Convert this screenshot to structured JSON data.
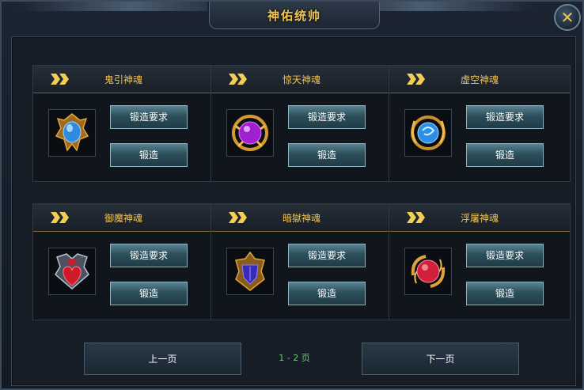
{
  "window": {
    "title": "神佑统帅",
    "close_icon": "close-x-icon"
  },
  "cards": [
    {
      "name": "鬼引神魂",
      "req_label": "锻造要求",
      "forge_label": "锻造",
      "icon": "blue-crystal-emblem-icon",
      "color": "#2f8be0"
    },
    {
      "name": "惊天神魂",
      "req_label": "锻造要求",
      "forge_label": "锻造",
      "icon": "purple-orb-emblem-icon",
      "color": "#a020d0"
    },
    {
      "name": "虚空神魂",
      "req_label": "锻造要求",
      "forge_label": "锻造",
      "icon": "blue-swirl-orb-icon",
      "color": "#2a8fe8"
    },
    {
      "name": "御魔神魂",
      "req_label": "锻造要求",
      "forge_label": "锻造",
      "icon": "red-heart-shield-icon",
      "color": "#d01a2a"
    },
    {
      "name": "暗獄神魂",
      "req_label": "锻造要求",
      "forge_label": "锻造",
      "icon": "dark-purple-shield-icon",
      "color": "#3a2ab8"
    },
    {
      "name": "浮屠神魂",
      "req_label": "锻造要求",
      "forge_label": "锻造",
      "icon": "red-swirl-orb-icon",
      "color": "#d0203a"
    }
  ],
  "pagination": {
    "prev_label": "上一页",
    "next_label": "下一页",
    "indicator": "1 - 2 页"
  },
  "colors": {
    "title_gold": "#f2c44b",
    "button_teal": "#2b4f5b",
    "page_indicator_green": "#5fd45a"
  }
}
